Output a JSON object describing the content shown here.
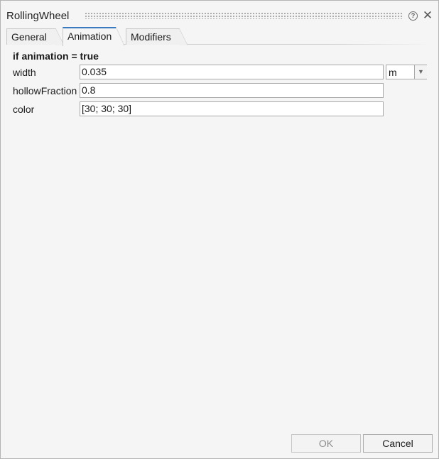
{
  "window": {
    "title": "RollingWheel"
  },
  "tabs": [
    {
      "label": "General",
      "active": false
    },
    {
      "label": "Animation",
      "active": true
    },
    {
      "label": "Modifiers",
      "active": false
    }
  ],
  "section": {
    "header": "if animation = true"
  },
  "params": {
    "width": {
      "label": "width",
      "value": "0.035",
      "unit": "m"
    },
    "hollowFraction": {
      "label": "hollowFraction",
      "value": "0.8"
    },
    "color": {
      "label": "color",
      "value": "[30; 30; 30]"
    }
  },
  "buttons": {
    "ok": "OK",
    "cancel": "Cancel"
  },
  "icons": {
    "help": "help-icon",
    "close": "close-icon",
    "dropdown": "chevron-down-icon"
  },
  "colors": {
    "active_tab_accent": "#3a7bbf",
    "dialog_bg": "#f5f5f5"
  }
}
